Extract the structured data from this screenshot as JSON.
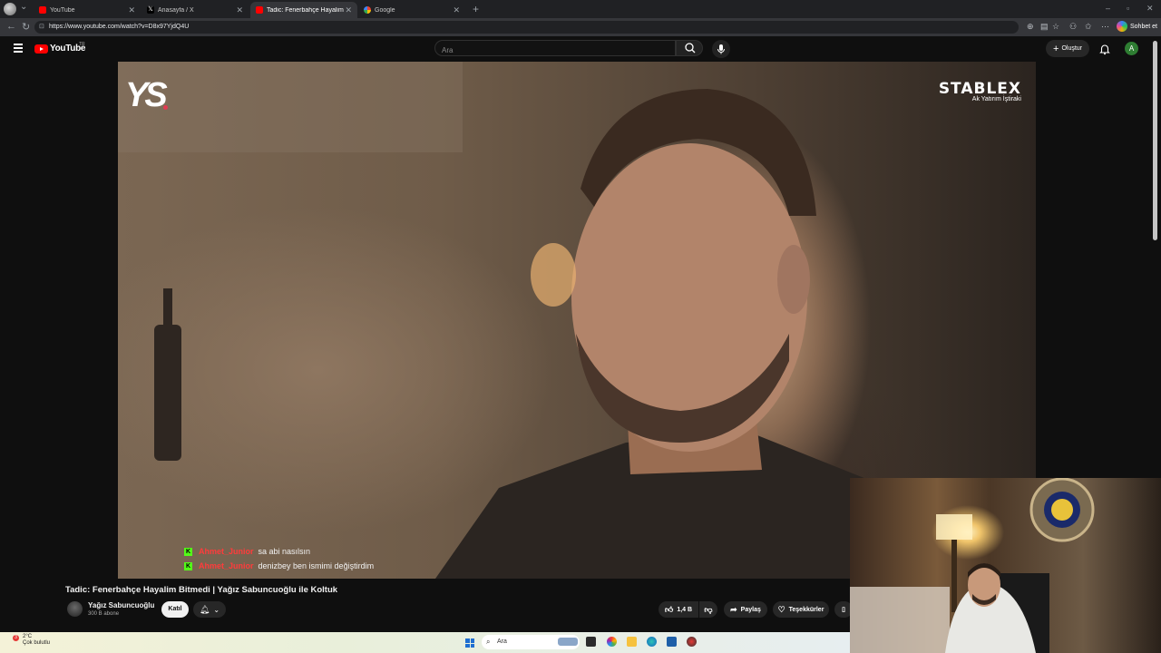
{
  "browser": {
    "tabs": [
      {
        "title": "YouTube",
        "active": false
      },
      {
        "title": "Anasayfa / X",
        "active": false
      },
      {
        "title": "Tadic: Fenerbahçe Hayalim Bitmedi | Yağız Sabuncuoğlu ile Koltuk",
        "active": true
      },
      {
        "title": "Google",
        "active": false
      }
    ],
    "url": "https://www.youtube.com/watch?v=D8x97YjdQ4U",
    "chat_button": "Sohbet et"
  },
  "youtube": {
    "logo_text": "YouTube",
    "country_code": "TR",
    "search_placeholder": "Ara",
    "create_label": "Oluştur",
    "avatar_letter": "A"
  },
  "video": {
    "channel_logo": "YS",
    "sponsor_name": "STABLEX",
    "sponsor_sub": "Ak Yatırım İştiraki",
    "title": "Tadic: Fenerbahçe Hayalim Bitmedi | Yağız Sabuncuoğlu ile Koltuk",
    "channel_name": "Yağız Sabuncuoğlu",
    "subscribers": "300 B abone",
    "join_label": "Katıl",
    "likes": "1,4 B",
    "share_label": "Paylaş",
    "thanks_label": "Teşekkürler"
  },
  "chat_overlay": [
    {
      "platform_badge": "K",
      "user": "Ahmet_Junior",
      "message": "sa abi nasılsın"
    },
    {
      "platform_badge": "K",
      "user": "Ahmet_Junior",
      "message": "denizbey ben ismimi değiştirdim"
    }
  ],
  "taskbar": {
    "weather_badge": "3",
    "temperature": "2°C",
    "weather_text": "Çok bulutlu",
    "search_placeholder": "Ara"
  }
}
